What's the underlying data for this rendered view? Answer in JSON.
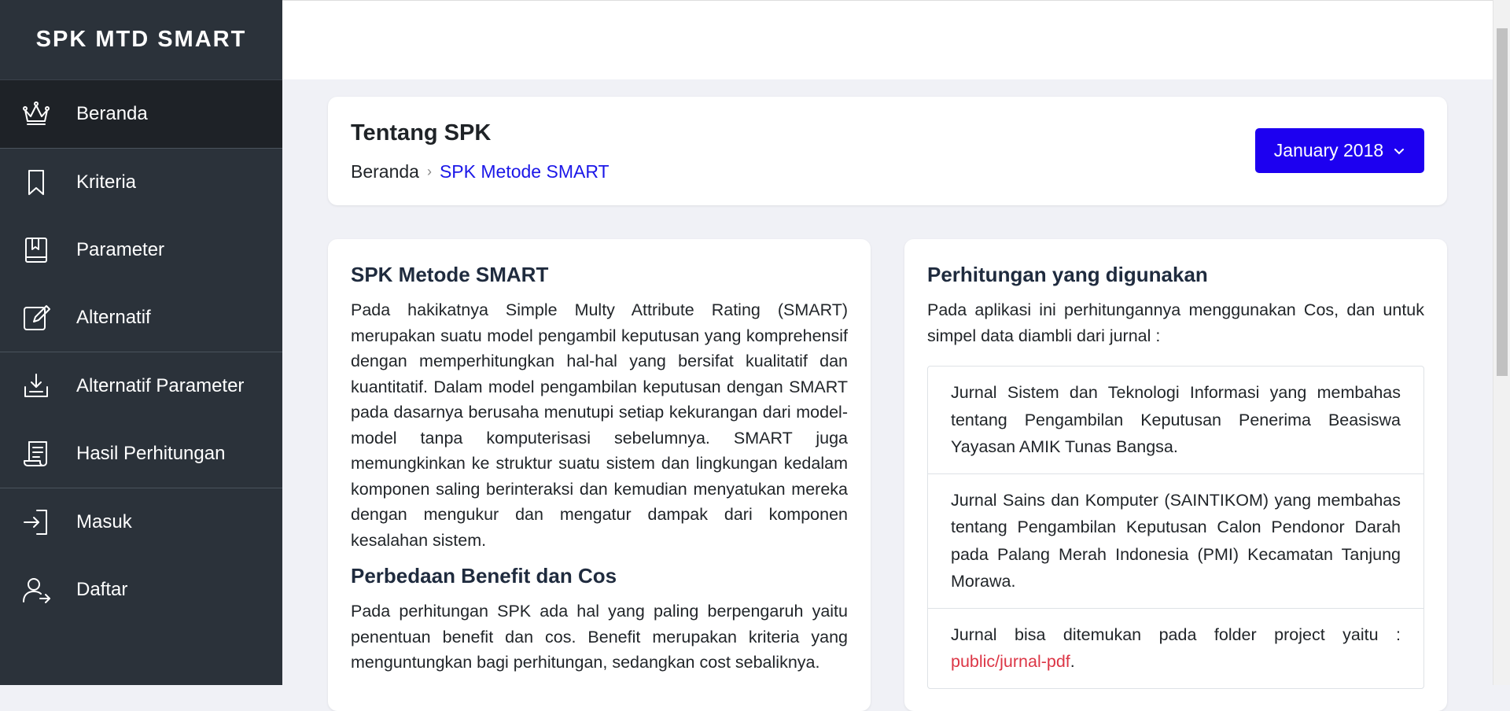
{
  "app": {
    "brand": "SPK MTD SMART"
  },
  "sidebar": {
    "items": [
      {
        "label": "Beranda",
        "icon": "crown-icon",
        "active": true
      },
      {
        "label": "Kriteria",
        "icon": "bookmark-icon"
      },
      {
        "label": "Parameter",
        "icon": "book-icon"
      },
      {
        "label": "Alternatif",
        "icon": "edit-icon"
      },
      {
        "label": "Alternatif Parameter",
        "icon": "download-tray-icon"
      },
      {
        "label": "Hasil Perhitungan",
        "icon": "scroll-icon"
      },
      {
        "label": "Masuk",
        "icon": "login-icon"
      },
      {
        "label": "Daftar",
        "icon": "user-plus-icon"
      }
    ]
  },
  "header": {
    "title": "Tentang SPK",
    "breadcrumb": {
      "home": "Beranda",
      "separator": "›",
      "current": "SPK Metode SMART"
    },
    "period_button": "January 2018"
  },
  "left": {
    "title1": "SPK Metode SMART",
    "para1": "Pada hakikatnya Simple Multy Attribute Rating (SMART) merupakan suatu model pengambil keputusan yang komprehensif dengan memperhitungkan hal-hal yang bersifat kualitatif dan kuantitatif. Dalam model pengambilan keputusan dengan SMART pada dasarnya berusaha menutupi setiap kekurangan dari model-model tanpa komputerisasi sebelumnya. SMART juga memungkinkan ke struktur suatu sistem dan lingkungan kedalam komponen saling berinteraksi dan kemudian menyatukan mereka dengan mengukur dan mengatur dampak dari komponen kesalahan sistem.",
    "title2": "Perbedaan Benefit dan Cos",
    "para2": "Pada perhitungan SPK ada hal yang paling berpengaruh yaitu penentuan benefit dan cos. Benefit merupakan kriteria yang menguntungkan bagi perhitungan, sedangkan cost sebaliknya."
  },
  "right": {
    "title": "Perhitungan yang digunakan",
    "intro": "Pada aplikasi ini perhitungannya menggunakan Cos, dan untuk simpel data diambli dari jurnal :",
    "journals": [
      "Jurnal Sistem dan Teknologi Informasi yang membahas tentang Pengambilan Keputusan Penerima Beasiswa Yayasan AMIK Tunas Bangsa.",
      "Jurnal Sains dan Komputer (SAINTIKOM) yang membahas tentang Pengambilan Keputusan Calon Pendonor Darah pada Palang Merah Indonesia (PMI) Kecamatan Tanjung Morawa."
    ],
    "folder_text": "Jurnal bisa ditemukan pada folder project yaitu :",
    "folder_path": "public/jurnal-pdf",
    "folder_end": "."
  },
  "colors": {
    "sidebar_bg": "#2b323a",
    "sidebar_active": "#1e2227",
    "primary": "#1d00f0",
    "breadcrumb_link": "#1b17e8",
    "link_red": "#dc3545",
    "page_bg": "#f0f1f6"
  }
}
